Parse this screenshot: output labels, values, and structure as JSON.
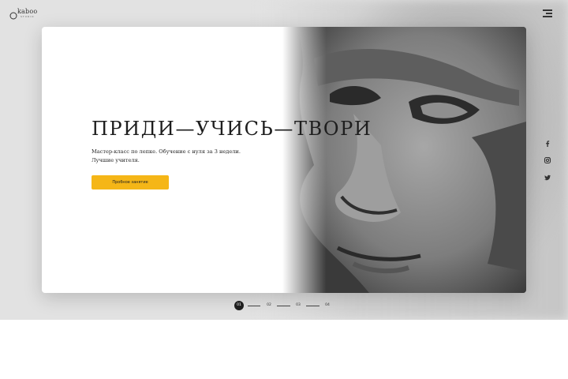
{
  "brand": {
    "name": "kaboo",
    "tagline": "STUDIO"
  },
  "hero": {
    "headline": "ПРИДИ—УЧИСЬ—ТВОРИ",
    "subtitle_line1": "Мастер-класс по лепке. Обучение с нуля за 3 недели.",
    "subtitle_line2": "Лучшие учителя.",
    "cta_label": "Пробное занятие"
  },
  "social": [
    "facebook-icon",
    "instagram-icon",
    "twitter-icon"
  ],
  "pagination": {
    "pages": [
      "01",
      "02",
      "03",
      "04"
    ],
    "active": "01"
  },
  "colors": {
    "accent": "#f5b617",
    "text": "#1e1e1e",
    "background": "#e2e2e2"
  }
}
